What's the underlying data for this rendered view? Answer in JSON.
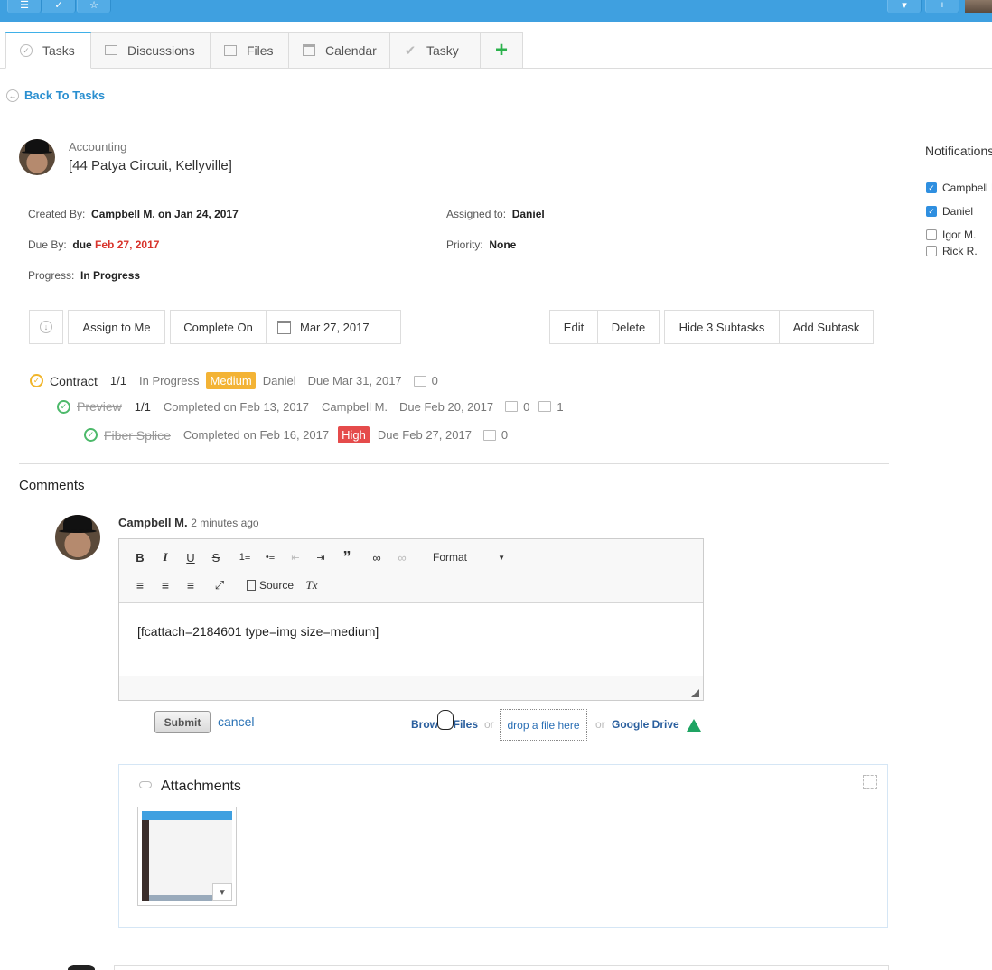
{
  "tabs": [
    {
      "label": "Tasks",
      "icon": "check-circle-icon"
    },
    {
      "label": "Discussions",
      "icon": "chat-icon"
    },
    {
      "label": "Files",
      "icon": "folder-icon"
    },
    {
      "label": "Calendar",
      "icon": "calendar-icon"
    },
    {
      "label": "Tasky",
      "icon": "checkmark-icon"
    }
  ],
  "back_label": "Back To Tasks",
  "project": {
    "label": "Accounting",
    "title": "[44 Patya Circuit, Kellyville]"
  },
  "meta": {
    "created_by_label": "Created By:",
    "created_by_value": "Campbell M. on Jan 24, 2017",
    "assigned_label": "Assigned to:",
    "assigned_value": "Daniel",
    "due_label": "Due By:",
    "due_prefix": "due",
    "due_date": "Feb 27, 2017",
    "priority_label": "Priority:",
    "priority_value": "None",
    "progress_label": "Progress:",
    "progress_value": "In Progress"
  },
  "notifications": {
    "title": "Notifications",
    "people": [
      {
        "name": "Campbell M.",
        "checked": true
      },
      {
        "name": "Daniel",
        "checked": true
      },
      {
        "name": "Igor M.",
        "checked": false
      },
      {
        "name": "Rick R.",
        "checked": false
      }
    ]
  },
  "actions": {
    "assign": "Assign to Me",
    "complete_on": "Complete On",
    "complete_date": "Mar 27, 2017",
    "edit": "Edit",
    "delete": "Delete",
    "hide_subtasks": "Hide 3 Subtasks",
    "add_subtask": "Add Subtask"
  },
  "tasks": [
    {
      "name": "Contract",
      "count": "1/1",
      "status": "In Progress",
      "priority": "Medium",
      "assignee": "Daniel",
      "due": "Due Mar 31, 2017",
      "comments": "0"
    },
    {
      "name": "Preview",
      "count": "1/1",
      "status": "Completed on Feb 13, 2017",
      "assignee": "Campbell M.",
      "due": "Due Feb 20, 2017",
      "comments": "0",
      "files": "1"
    },
    {
      "name": "Fiber Splice",
      "status": "Completed on Feb 16, 2017",
      "priority": "High",
      "due": "Due Feb 27, 2017",
      "comments": "0"
    }
  ],
  "comments": {
    "heading": "Comments",
    "author": "Campbell M.",
    "time": "2 minutes ago",
    "editor_text": "[fcattach=2184601 type=img size=medium]",
    "toolbar": {
      "format": "Format",
      "source": "Source"
    }
  },
  "upload": {
    "submit": "Submit",
    "cancel": "cancel",
    "browse": "Browse Files",
    "or": "or",
    "drop": "drop a file here",
    "google": "Google Drive"
  },
  "attachments": {
    "title": "Attachments"
  },
  "colors": {
    "topbar": "#3fa0e0",
    "link": "#2a8fd0",
    "medium": "#f3b335",
    "high": "#e54b4b",
    "done": "#4cb96a"
  }
}
